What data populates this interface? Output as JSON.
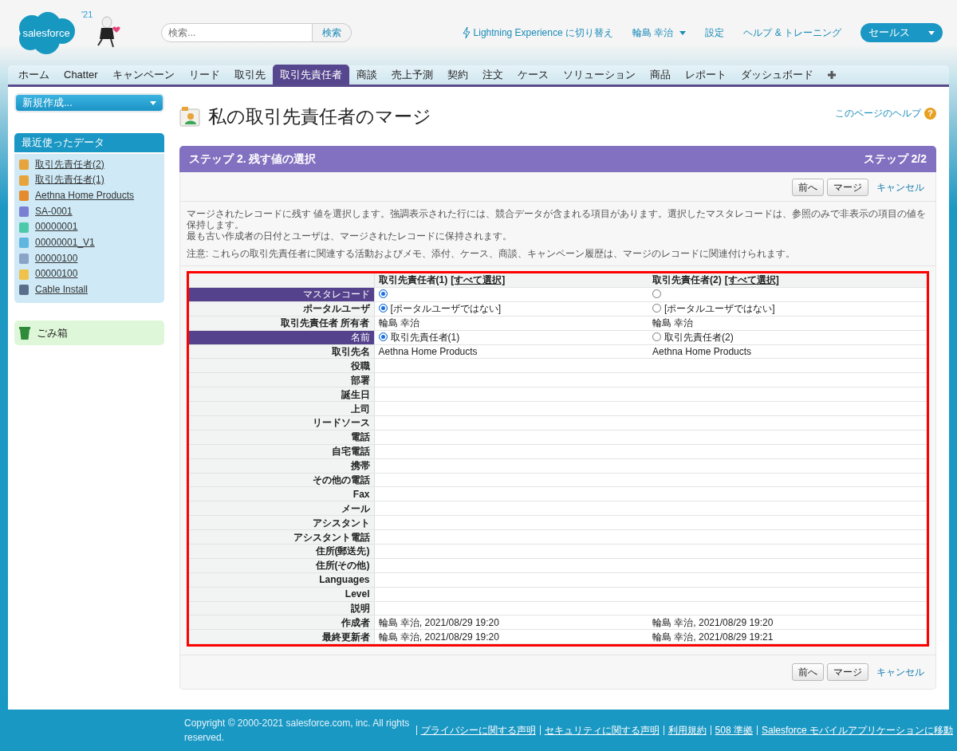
{
  "header": {
    "logo_text": "salesforce",
    "logo_year": "'21",
    "search": {
      "placeholder": "検索...",
      "button": "検索"
    },
    "lightning_link": "Lightning Experience に切り替え",
    "user_menu": "輪島 幸治",
    "setup": "設定",
    "help": "ヘルプ & トレーニング",
    "app_menu": "セールス"
  },
  "tabs": [
    {
      "label": "ホーム",
      "selected": false
    },
    {
      "label": "Chatter",
      "selected": false
    },
    {
      "label": "キャンペーン",
      "selected": false
    },
    {
      "label": "リード",
      "selected": false
    },
    {
      "label": "取引先",
      "selected": false
    },
    {
      "label": "取引先責任者",
      "selected": true
    },
    {
      "label": "商談",
      "selected": false
    },
    {
      "label": "売上予測",
      "selected": false
    },
    {
      "label": "契約",
      "selected": false
    },
    {
      "label": "注文",
      "selected": false
    },
    {
      "label": "ケース",
      "selected": false
    },
    {
      "label": "ソリューション",
      "selected": false
    },
    {
      "label": "商品",
      "selected": false
    },
    {
      "label": "レポート",
      "selected": false
    },
    {
      "label": "ダッシュボード",
      "selected": false
    }
  ],
  "sidebar": {
    "create_new": "新規作成...",
    "recent_title": "最近使ったデータ",
    "recent_items": [
      {
        "label": "取引先責任者(2)",
        "color": "#e8a33c"
      },
      {
        "label": "取引先責任者(1)",
        "color": "#e8a33c"
      },
      {
        "label": "Aethna Home Products",
        "color": "#e68a2e"
      },
      {
        "label": "SA-0001",
        "color": "#7b7fd4"
      },
      {
        "label": "00000001",
        "color": "#4cc9a8"
      },
      {
        "label": "00000001_V1",
        "color": "#5fb6de"
      },
      {
        "label": "00000100",
        "color": "#8aa4c8"
      },
      {
        "label": "00000100",
        "color": "#f0c24a"
      },
      {
        "label": "Cable Install",
        "color": "#5a6e8c"
      }
    ],
    "recycle_bin": "ごみ箱"
  },
  "page": {
    "title": "私の取引先責任者のマージ",
    "help_link": "このページのヘルプ",
    "help_badge": "?",
    "step_title": "ステップ 2. 残す値の選択",
    "step_count": "ステップ 2/2",
    "buttons_top": {
      "previous": "前へ",
      "merge": "マージ",
      "cancel": "キャンセル"
    },
    "description": [
      "マージされたレコードに残す 値を選択します。強調表示された行には、競合データが含まれる項目があります。選択したマスタレコードは、参照のみで非表示の項目の値を保持します。",
      "最も古い作成者の日付とユーザは、マージされたレコードに保持されます。"
    ],
    "note": "注意: これらの取引先責任者に関連する活動およびメモ、添付、ケース、商談、キャンペーン履歴は、マージのレコードに関連付けられます。",
    "table": {
      "columns": [
        {
          "title": "取引先責任者(1)",
          "select_all": "[すべて選択]"
        },
        {
          "title": "取引先責任者(2)",
          "select_all": "[すべて選択]"
        }
      ],
      "rows": [
        {
          "label": "マスタレコード",
          "highlighted": true,
          "values": [
            {
              "kind": "radio",
              "selected": true
            },
            {
              "kind": "radio",
              "selected": false
            }
          ]
        },
        {
          "label": "ポータルユーザ",
          "highlighted": false,
          "values": [
            {
              "kind": "radio",
              "selected": true,
              "text": "[ポータルユーザではない]"
            },
            {
              "kind": "radio",
              "selected": false,
              "text": "[ポータルユーザではない]"
            }
          ]
        },
        {
          "label": "取引先責任者 所有者",
          "highlighted": false,
          "values": [
            {
              "kind": "text",
              "text": "輪島 幸治"
            },
            {
              "kind": "text",
              "text": "輪島 幸治"
            }
          ]
        },
        {
          "label": "名前",
          "highlighted": true,
          "values": [
            {
              "kind": "radio",
              "selected": true,
              "text": "取引先責任者(1)"
            },
            {
              "kind": "radio",
              "selected": false,
              "text": "取引先責任者(2)"
            }
          ]
        },
        {
          "label": "取引先名",
          "highlighted": false,
          "values": [
            {
              "kind": "text",
              "text": "Aethna Home Products"
            },
            {
              "kind": "text",
              "text": "Aethna Home Products"
            }
          ]
        },
        {
          "label": "役職",
          "highlighted": false
        },
        {
          "label": "部署",
          "highlighted": false
        },
        {
          "label": "誕生日",
          "highlighted": false
        },
        {
          "label": "上司",
          "highlighted": false
        },
        {
          "label": "リードソース",
          "highlighted": false
        },
        {
          "label": "電話",
          "highlighted": false
        },
        {
          "label": "自宅電話",
          "highlighted": false
        },
        {
          "label": "携帯",
          "highlighted": false
        },
        {
          "label": "その他の電話",
          "highlighted": false
        },
        {
          "label": "Fax",
          "highlighted": false
        },
        {
          "label": "メール",
          "highlighted": false
        },
        {
          "label": "アシスタント",
          "highlighted": false
        },
        {
          "label": "アシスタント電話",
          "highlighted": false
        },
        {
          "label": "住所(郵送先)",
          "highlighted": false
        },
        {
          "label": "住所(その他)",
          "highlighted": false
        },
        {
          "label": "Languages",
          "highlighted": false
        },
        {
          "label": "Level",
          "highlighted": false
        },
        {
          "label": "説明",
          "highlighted": false
        },
        {
          "label": "作成者",
          "highlighted": false,
          "values": [
            {
              "kind": "text",
              "text": "輪島 幸治, 2021/08/29 19:20"
            },
            {
              "kind": "text",
              "text": "輪島 幸治, 2021/08/29 19:20"
            }
          ]
        },
        {
          "label": "最終更新者",
          "highlighted": false,
          "values": [
            {
              "kind": "text",
              "text": "輪島 幸治, 2021/08/29 19:20"
            },
            {
              "kind": "text",
              "text": "輪島 幸治, 2021/08/29 19:21"
            }
          ]
        }
      ]
    },
    "buttons_bottom": {
      "previous": "前へ",
      "merge": "マージ",
      "cancel": "キャンセル"
    }
  },
  "footer": {
    "copyright": "Copyright © 2000-2021 salesforce.com, inc. All rights reserved.",
    "links": [
      "プライバシーに関する声明",
      "セキュリティに関する声明",
      "利用規約",
      "508 準拠",
      "Salesforce モバイルアプリケーションに移動"
    ]
  }
}
